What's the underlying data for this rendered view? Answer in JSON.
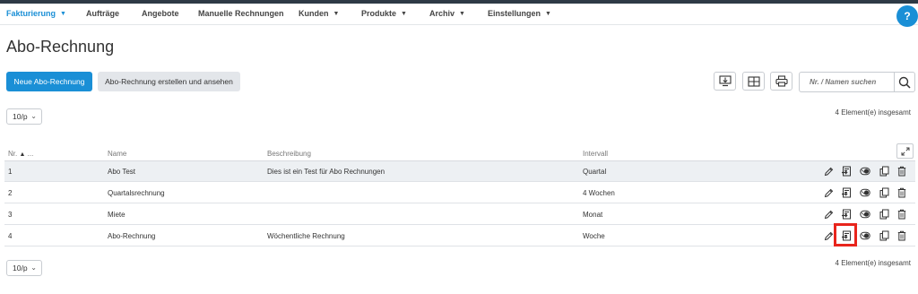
{
  "nav": {
    "items": [
      {
        "label": "Fakturierung",
        "caret": "▼"
      },
      {
        "label": "Aufträge",
        "caret": ""
      },
      {
        "label": "Angebote",
        "caret": ""
      },
      {
        "label": "Manuelle Rechnungen",
        "caret": ""
      },
      {
        "label": "Kunden",
        "caret": "▼"
      },
      {
        "label": "Produkte",
        "caret": "▼"
      },
      {
        "label": "Archiv",
        "caret": "▼"
      },
      {
        "label": "Einstellungen",
        "caret": "▼"
      }
    ],
    "help_label": "?"
  },
  "page": {
    "title": "Abo-Rechnung"
  },
  "toolbar": {
    "new_label": "Neue Abo-Rechnung",
    "create_view_label": "Abo-Rechnung erstellen und ansehen",
    "search_placeholder": "Nr. / Namen suchen"
  },
  "pagination": {
    "per_page": "10/p",
    "count_label": "4 Element(e) insgesamt"
  },
  "table": {
    "columns": {
      "nr": "Nr.",
      "nr_extra": "...",
      "name": "Name",
      "description": "Beschreibung",
      "interval": "Intervall"
    },
    "rows": [
      {
        "nr": "1",
        "name": "Abo Test",
        "description": "Dies ist ein Test für Abo Rechnungen",
        "interval": "Quartal"
      },
      {
        "nr": "2",
        "name": "Quartalsrechnung",
        "description": "",
        "interval": "4 Wochen"
      },
      {
        "nr": "3",
        "name": "Miete",
        "description": "",
        "interval": "Monat"
      },
      {
        "nr": "4",
        "name": "Abo-Rechnung",
        "description": "Wöchentliche Rechnung",
        "interval": "Woche"
      }
    ]
  },
  "colors": {
    "accent": "#1a8fd6",
    "highlight": "#e8241c",
    "row_hover": "#edf0f3"
  },
  "icons": [
    "download-icon",
    "columns-icon",
    "print-icon",
    "search-icon",
    "expand-icon",
    "edit-icon",
    "generate-invoice-icon",
    "toggle-icon",
    "copy-icon",
    "delete-icon"
  ]
}
